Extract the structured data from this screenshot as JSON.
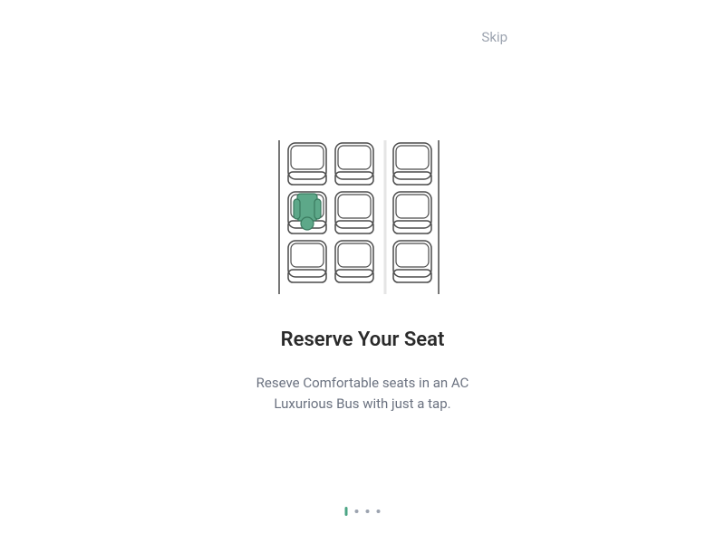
{
  "skip": {
    "label": "Skip"
  },
  "onboarding": {
    "title": "Reserve Your Seat",
    "subtitle_line1": "Reseve Comfortable seats in an AC",
    "subtitle_line2": "Luxurious Bus with just a tap."
  },
  "pagination": {
    "total": 4,
    "active": 0
  }
}
